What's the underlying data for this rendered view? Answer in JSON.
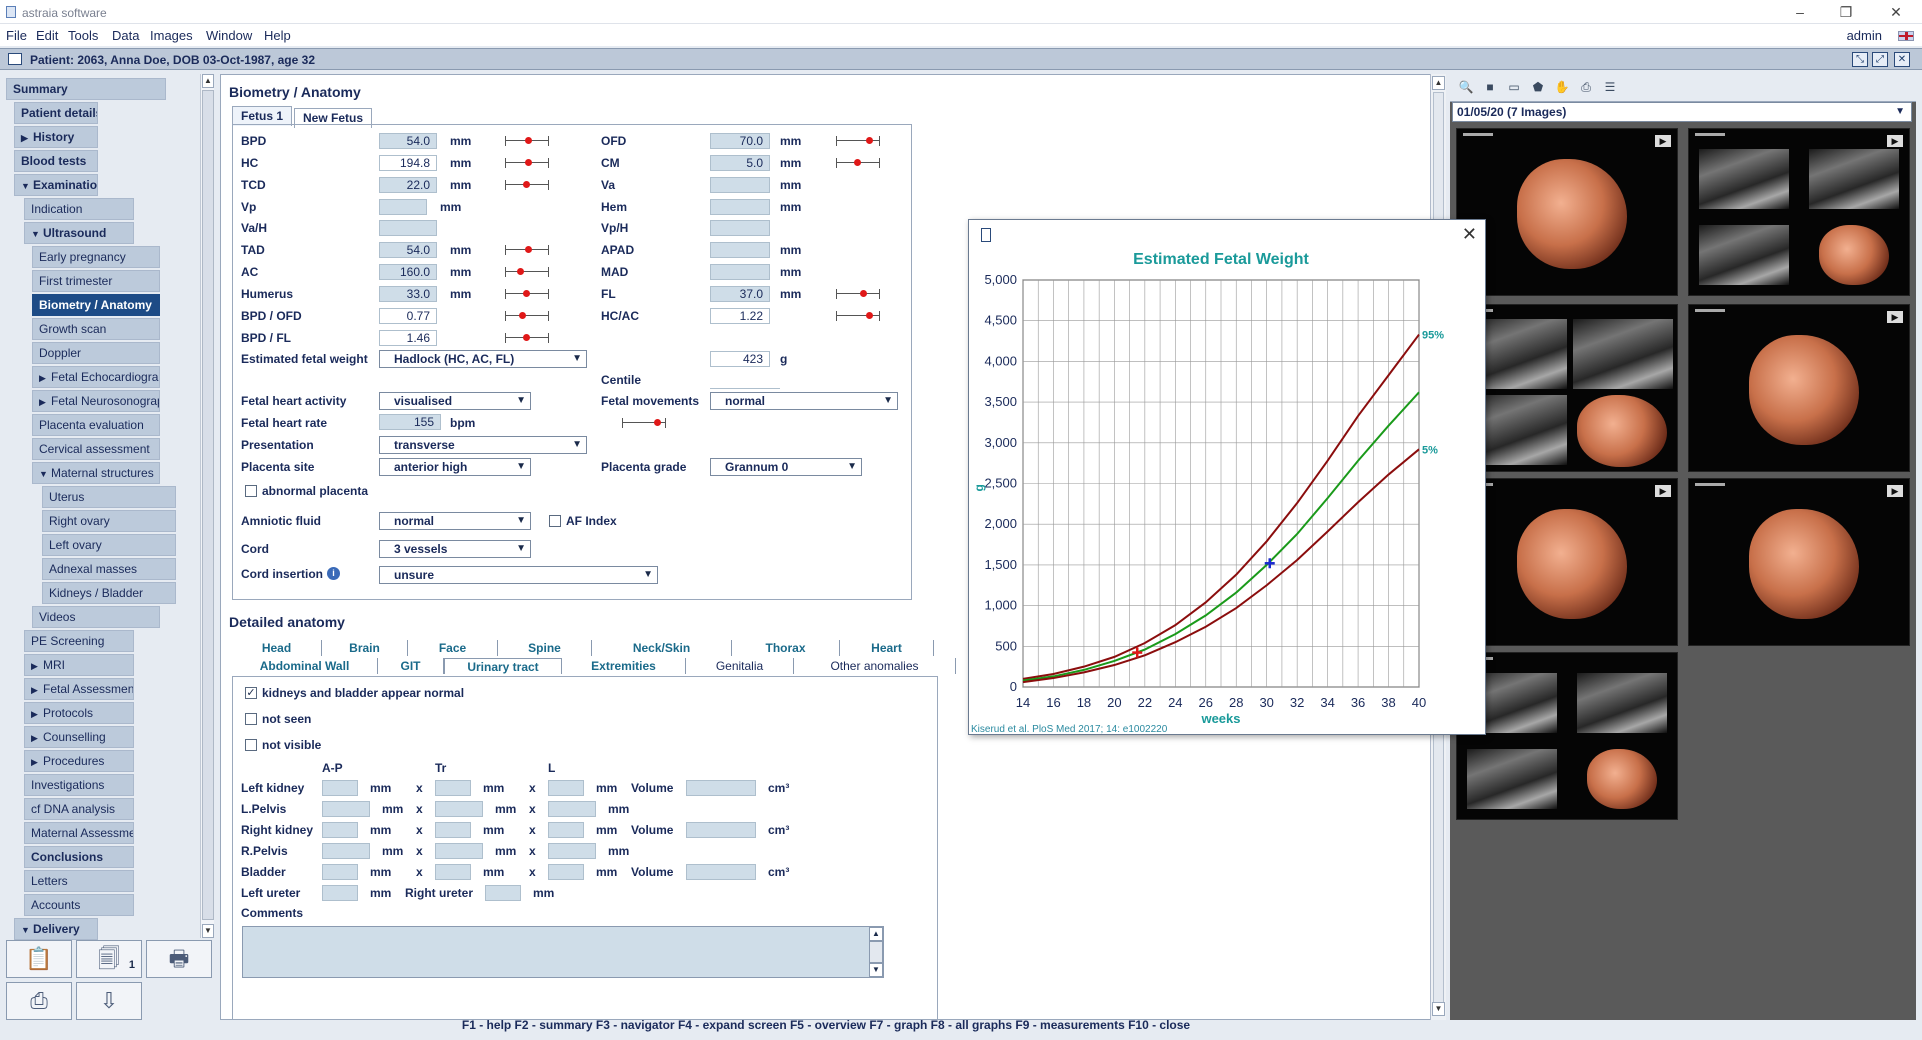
{
  "app": {
    "title": "astraia software",
    "user": "admin"
  },
  "menu": [
    "File",
    "Edit",
    "Tools",
    "Data",
    "Images",
    "Window",
    "Help"
  ],
  "patient": "Patient:  2063, Anna Doe, DOB 03-Oct-1987, age 32",
  "nav": [
    {
      "label": "Summary",
      "bold": true,
      "level": 0
    },
    {
      "label": "Patient details",
      "bold": true,
      "level": 1
    },
    {
      "label": "History",
      "bold": true,
      "level": 1,
      "tri": "right"
    },
    {
      "label": "Blood tests",
      "bold": true,
      "level": 1
    },
    {
      "label": "Examination",
      "bold": true,
      "level": 1,
      "tri": "down"
    },
    {
      "label": "Indication",
      "level": 2
    },
    {
      "label": "Ultrasound",
      "bold": true,
      "level": 2,
      "tri": "down"
    },
    {
      "label": "Early pregnancy",
      "level": 3
    },
    {
      "label": "First trimester",
      "level": 3
    },
    {
      "label": "Biometry / Anatomy",
      "level": 3,
      "selected": true
    },
    {
      "label": "Growth scan",
      "level": 3
    },
    {
      "label": "Doppler",
      "level": 3
    },
    {
      "label": "Fetal Echocardiography",
      "level": 3,
      "tri": "right"
    },
    {
      "label": "Fetal Neurosonography",
      "level": 3,
      "tri": "right"
    },
    {
      "label": "Placenta evaluation",
      "level": 3
    },
    {
      "label": "Cervical assessment",
      "level": 3
    },
    {
      "label": "Maternal structures",
      "level": 3,
      "tri": "down"
    },
    {
      "label": "Uterus",
      "level": 4
    },
    {
      "label": "Right ovary",
      "level": 4
    },
    {
      "label": "Left ovary",
      "level": 4
    },
    {
      "label": "Adnexal masses",
      "level": 4
    },
    {
      "label": "Kidneys / Bladder",
      "level": 4
    },
    {
      "label": "Videos",
      "level": 3
    },
    {
      "label": "PE Screening",
      "level": 2
    },
    {
      "label": "MRI",
      "level": 2,
      "tri": "right"
    },
    {
      "label": "Fetal Assessment",
      "level": 2,
      "tri": "right"
    },
    {
      "label": "Protocols",
      "level": 2,
      "tri": "right"
    },
    {
      "label": "Counselling",
      "level": 2,
      "tri": "right"
    },
    {
      "label": "Procedures",
      "level": 2,
      "tri": "right"
    },
    {
      "label": "Investigations",
      "level": 2
    },
    {
      "label": "cf DNA analysis",
      "level": 2
    },
    {
      "label": "Maternal Assessment",
      "level": 2
    },
    {
      "label": "Conclusions",
      "bold": true,
      "level": 2
    },
    {
      "label": "Letters",
      "level": 2
    },
    {
      "label": "Accounts",
      "level": 2
    },
    {
      "label": "Delivery",
      "bold": true,
      "level": 1,
      "tri": "down"
    }
  ],
  "toolbar": {
    "badge": "1"
  },
  "biometry": {
    "title": "Biometry / Anatomy",
    "tabs": [
      "Fetus 1",
      "New Fetus"
    ],
    "left": [
      {
        "label": "BPD",
        "value": "54.0",
        "unit": "mm",
        "gauge": 0.5
      },
      {
        "label": "HC",
        "value": "194.8",
        "unit": "mm",
        "gauge": 0.5,
        "white": true
      },
      {
        "label": "TCD",
        "value": "22.0",
        "unit": "mm",
        "gauge": 0.45
      },
      {
        "label": "Vp",
        "value": "",
        "unit": "mm"
      },
      {
        "label": "Va/H",
        "value": "",
        "unit": ""
      },
      {
        "label": "TAD",
        "value": "54.0",
        "unit": "mm",
        "gauge": 0.5
      },
      {
        "label": "AC",
        "value": "160.0",
        "unit": "mm",
        "gauge": 0.3
      },
      {
        "label": "Humerus",
        "value": "33.0",
        "unit": "mm",
        "gauge": 0.45
      },
      {
        "label": "BPD / OFD",
        "value": "0.77",
        "unit": "",
        "gauge": 0.35,
        "white": true
      },
      {
        "label": "BPD / FL",
        "value": "1.46",
        "unit": "",
        "gauge": 0.45,
        "white": true
      }
    ],
    "right": [
      {
        "label": "OFD",
        "value": "70.0",
        "unit": "mm",
        "gauge": 0.75
      },
      {
        "label": "CM",
        "value": "5.0",
        "unit": "mm",
        "gauge": 0.45
      },
      {
        "label": "Va",
        "value": "",
        "unit": "mm"
      },
      {
        "label": "Hem",
        "value": "",
        "unit": "mm"
      },
      {
        "label": "Vp/H",
        "value": "",
        "unit": ""
      },
      {
        "label": "APAD",
        "value": "",
        "unit": "mm"
      },
      {
        "label": "MAD",
        "value": "",
        "unit": "mm"
      },
      {
        "label": "FL",
        "value": "37.0",
        "unit": "mm",
        "gauge": 0.6
      },
      {
        "label": "HC/AC",
        "value": "1.22",
        "unit": "",
        "gauge": 0.75,
        "white": true
      }
    ],
    "efw_label": "Estimated fetal weight",
    "efw_method": "Hadlock (HC, AC, FL)",
    "efw_value": "423",
    "efw_unit": "g",
    "centile_label": "Centile",
    "heart_activity_label": "Fetal heart activity",
    "heart_activity": "visualised",
    "movements_label": "Fetal movements",
    "movements": "normal",
    "heart_rate_label": "Fetal heart rate",
    "heart_rate": "155",
    "heart_rate_unit": "bpm",
    "presentation_label": "Presentation",
    "presentation": "transverse",
    "placenta_site_label": "Placenta site",
    "placenta_site": "anterior high",
    "placenta_grade_label": "Placenta grade",
    "placenta_grade": "Grannum 0",
    "abnormal_placenta": "abnormal placenta",
    "amniotic_label": "Amniotic fluid",
    "amniotic": "normal",
    "af_index": "AF Index",
    "cord_label": "Cord",
    "cord": "3 vessels",
    "cord_insertion_label": "Cord insertion",
    "cord_insertion": "unsure"
  },
  "detailed": {
    "title": "Detailed anatomy",
    "tabs_row1": [
      "Head",
      "Brain",
      "Face",
      "Spine",
      "Neck/Skin",
      "Thorax",
      "Heart"
    ],
    "tabs_row2": [
      "Abdominal Wall",
      "GIT",
      "Urinary tract",
      "Extremities",
      "Genitalia",
      "Other anomalies"
    ],
    "checks": [
      {
        "label": "kidneys and bladder appear normal",
        "checked": true
      },
      {
        "label": "not seen",
        "checked": false
      },
      {
        "label": "not visible",
        "checked": false
      }
    ],
    "cols": [
      "A-P",
      "Tr",
      "L"
    ],
    "rows": [
      {
        "label": "Left kidney",
        "volume": true
      },
      {
        "label": "L.Pelvis",
        "volume": false
      },
      {
        "label": "Right kidney",
        "volume": true
      },
      {
        "label": "R.Pelvis",
        "volume": false
      },
      {
        "label": "Bladder",
        "volume": true
      }
    ],
    "mm": "mm",
    "x": "x",
    "volume_label": "Volume",
    "volume_unit": "cm³",
    "left_ureter": "Left ureter",
    "right_ureter": "Right ureter",
    "comments": "Comments"
  },
  "images": {
    "selector": "01/05/20   (7 Images)"
  },
  "fkeys": "F1 - help    F2 - summary    F3 - navigator    F4 - expand screen    F5 - overview    F7 - graph    F8 - all graphs    F9 - measurements    F10 - close",
  "chart_data": {
    "type": "line",
    "title": "Estimated Fetal Weight",
    "xlabel": "weeks",
    "ylabel": "g",
    "xlim": [
      14,
      40
    ],
    "ylim": [
      0,
      5000
    ],
    "xticks": [
      14,
      16,
      18,
      20,
      22,
      24,
      26,
      28,
      30,
      32,
      34,
      36,
      38,
      40
    ],
    "yticks": [
      0,
      500,
      1000,
      1500,
      2000,
      2500,
      3000,
      3500,
      4000,
      4500,
      5000
    ],
    "ytick_labels": [
      "0",
      "500",
      "1,000",
      "1,500",
      "2,000",
      "2,500",
      "3,000",
      "3,500",
      "4,000",
      "4,500",
      "5,000"
    ],
    "grid": true,
    "series": [
      {
        "name": "95%",
        "color": "#8b0d0d",
        "x": [
          14,
          16,
          18,
          20,
          22,
          24,
          26,
          28,
          30,
          32,
          34,
          36,
          38,
          40
        ],
        "y": [
          100,
          160,
          250,
          370,
          540,
          760,
          1040,
          1380,
          1790,
          2260,
          2780,
          3330,
          3830,
          4330
        ]
      },
      {
        "name": "",
        "color": "#1a9a1a",
        "x": [
          14,
          16,
          18,
          20,
          22,
          24,
          26,
          28,
          30,
          32,
          34,
          36,
          38,
          40
        ],
        "y": [
          80,
          130,
          210,
          320,
          460,
          650,
          880,
          1160,
          1500,
          1880,
          2320,
          2780,
          3210,
          3620
        ]
      },
      {
        "name": "5%",
        "color": "#8b0d0d",
        "x": [
          14,
          16,
          18,
          20,
          22,
          24,
          26,
          28,
          30,
          32,
          34,
          36,
          38,
          40
        ],
        "y": [
          60,
          110,
          180,
          270,
          390,
          550,
          740,
          970,
          1250,
          1560,
          1910,
          2270,
          2610,
          2920
        ]
      }
    ],
    "markers": [
      {
        "x": 21.5,
        "y": 423,
        "color": "#e01818"
      },
      {
        "x": 30.2,
        "y": 1520,
        "color": "#1a2ad0"
      }
    ],
    "source": "Kiserud et al. PloS Med 2017; 14: e1002220"
  }
}
